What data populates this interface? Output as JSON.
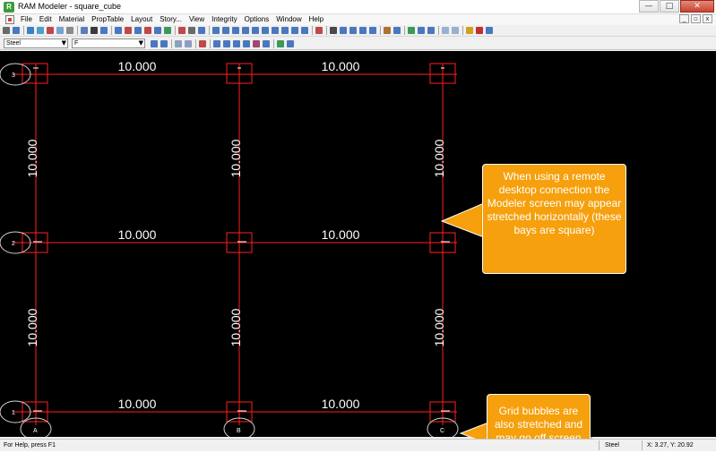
{
  "window": {
    "title": "RAM Modeler - square_cube",
    "controls": {
      "minimize": "—",
      "maximize": "□",
      "close": "✕"
    }
  },
  "menu": {
    "items": [
      "File",
      "Edit",
      "Material",
      "PropTable",
      "Layout",
      "Story...",
      "View",
      "Integrity",
      "Options",
      "Window",
      "Help"
    ],
    "mdi_controls": {
      "minimize": "_",
      "restore": "▫",
      "close": "x"
    }
  },
  "toolbar": {
    "groups": [
      [
        "#6a6a6a",
        "#4a78c0"
      ],
      [
        "#3d7ec8",
        "#4aa0d0",
        "#c04848",
        "#7aa0d0",
        "#8a8a8a"
      ],
      [
        "#5a7fb8",
        "#3a3a3a",
        "#4a78c0"
      ],
      [
        "#4a78c0",
        "#c04848",
        "#4a78c0",
        "#c04848",
        "#4a78c0",
        "#3a9a5a"
      ],
      [
        "#c04848",
        "#6a6a6a",
        "#4a78c0"
      ],
      [
        "#4a78c0",
        "#4a78c0",
        "#4a78c0",
        "#4a78c0",
        "#4a78c0",
        "#4a78c0",
        "#4a78c0",
        "#4a78c0",
        "#4a78c0",
        "#4a78c0"
      ],
      [
        "#c04848"
      ],
      [
        "#4a4a4a",
        "#4a78c0",
        "#4a78c0",
        "#4a78c0",
        "#4a78c0"
      ],
      [
        "#b07030",
        "#4a78c0"
      ],
      [
        "#3a9a5a",
        "#4a78c0",
        "#4a78c0"
      ],
      [
        "#9ab0d0",
        "#9ab0d0"
      ],
      [
        "#d0a020",
        "#c03030",
        "#4a78c0"
      ]
    ],
    "row2_groups": [
      [
        "#4a78c0",
        "#4a78c0"
      ],
      [
        "#8aa0c0",
        "#8aa0c0"
      ],
      [
        "#c04848"
      ],
      [
        "#4a78c0",
        "#4a78c0",
        "#4a78c0",
        "#4a78c0",
        "#a04870",
        "#4a78c0"
      ],
      [
        "#3a9a5a",
        "#4a78c0"
      ]
    ]
  },
  "selectors": {
    "member_type": "Steel",
    "story": "F",
    "arrow": "▼"
  },
  "drawing": {
    "colors": {
      "grid_line": "#ff2020",
      "bubble": "#d0d0d0",
      "text": "#ffffff",
      "background": "#000000"
    },
    "horizontal_dims": [
      "10.000",
      "10.000",
      "10.000",
      "10.000",
      "10.000",
      "10.000"
    ],
    "vertical_dims": [
      "10.000",
      "10.000",
      "10.000",
      "10.000",
      "10.000",
      "10.000"
    ],
    "row_bubbles": [
      "3",
      "2",
      "1"
    ],
    "column_bubbles": [
      "A",
      "B",
      "C"
    ]
  },
  "callouts": {
    "stretched_note": "When using a remote desktop connection the Modeler screen may appear stretched horizontally (these bays are square)",
    "bubble_note": "Grid bubbles are also stretched and may go off screen",
    "color": "#f5a00c"
  },
  "status": {
    "help": "For Help, press F1",
    "material": "Steel",
    "coords": "X:   3.27, Y:  20.92"
  }
}
